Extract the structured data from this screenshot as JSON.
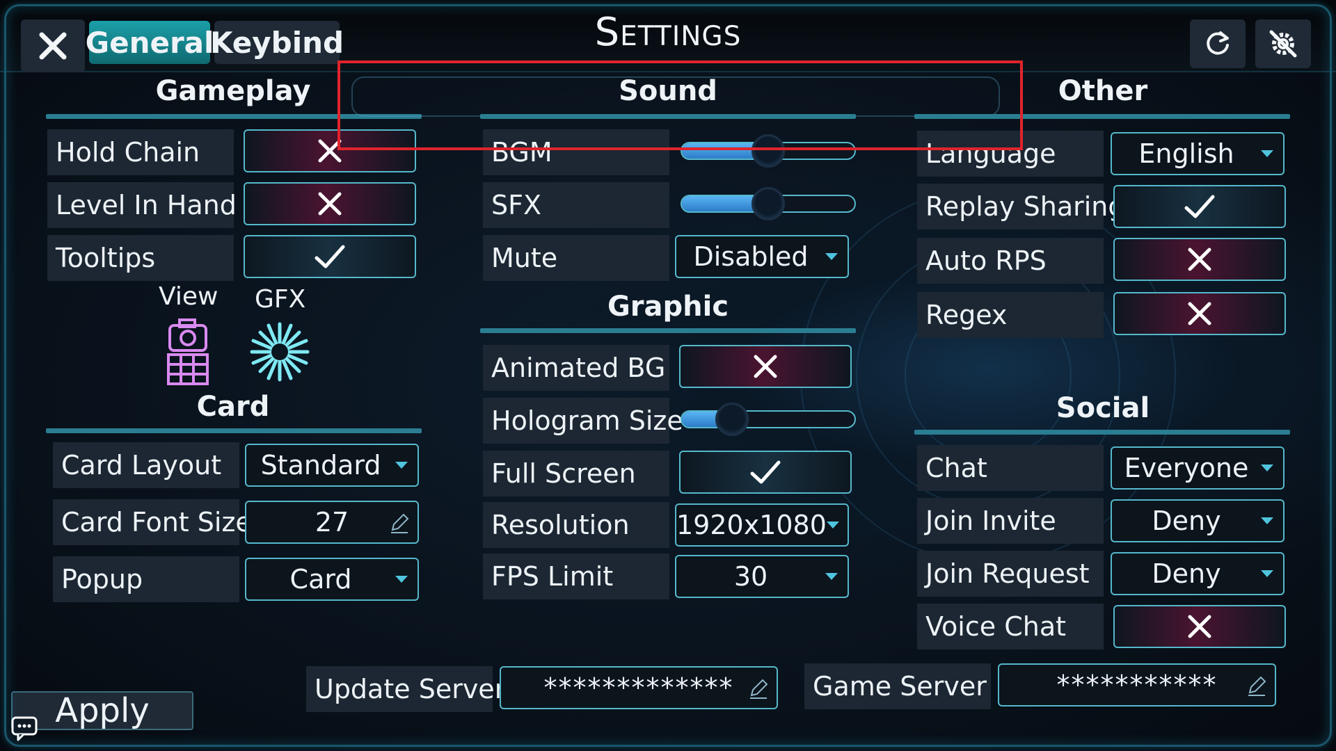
{
  "window": {
    "title": "Settings"
  },
  "tabs": [
    {
      "label": "General",
      "active": true
    },
    {
      "label": "Keybind",
      "active": false
    }
  ],
  "toolbar": {
    "reset_icon": "refresh-icon",
    "gear_icon": "gear-off-icon"
  },
  "gameplay": {
    "title": "Gameplay",
    "rows": [
      {
        "label": "Hold Chain",
        "value": "off"
      },
      {
        "label": "Level In Hand",
        "value": "off"
      },
      {
        "label": "Tooltips",
        "value": "on"
      }
    ],
    "view_label": "View",
    "gfx_label": "GFX"
  },
  "card": {
    "title": "Card",
    "layout_label": "Card Layout",
    "layout_value": "Standard",
    "font_size_label": "Card Font Size",
    "font_size_value": "27",
    "popup_label": "Popup",
    "popup_value": "Card"
  },
  "sound": {
    "title": "Sound",
    "bgm_label": "BGM",
    "bgm_level": 0.5,
    "sfx_label": "SFX",
    "sfx_level": 0.5,
    "mute_label": "Mute",
    "mute_value": "Disabled"
  },
  "graphic": {
    "title": "Graphic",
    "animated_bg_label": "Animated BG",
    "animated_bg_value": "off",
    "hologram_label": "Hologram Size",
    "hologram_level": 0.29,
    "fullscreen_label": "Full Screen",
    "fullscreen_value": "on",
    "resolution_label": "Resolution",
    "resolution_value": "1920x1080",
    "fps_label": "FPS Limit",
    "fps_value": "30"
  },
  "other": {
    "title": "Other",
    "language_label": "Language",
    "language_value": "English",
    "replay_label": "Replay Sharing",
    "replay_value": "on",
    "auto_rps_label": "Auto RPS",
    "auto_rps_value": "off",
    "regex_label": "Regex",
    "regex_value": "off"
  },
  "social": {
    "title": "Social",
    "chat_label": "Chat",
    "chat_value": "Everyone",
    "join_invite_label": "Join Invite",
    "join_invite_value": "Deny",
    "join_request_label": "Join Request",
    "join_request_value": "Deny",
    "voice_chat_label": "Voice Chat",
    "voice_chat_value": "off"
  },
  "servers": {
    "update_label": "Update Server",
    "update_value": "*************",
    "game_label": "Game Server",
    "game_value": "***********"
  },
  "footer": {
    "apply_label": "Apply"
  },
  "colors": {
    "accent": "#55b9cc",
    "tab_active": "#1b9fa8",
    "highlight": "#e0242c",
    "slider_fill": "#4a9fe6"
  }
}
